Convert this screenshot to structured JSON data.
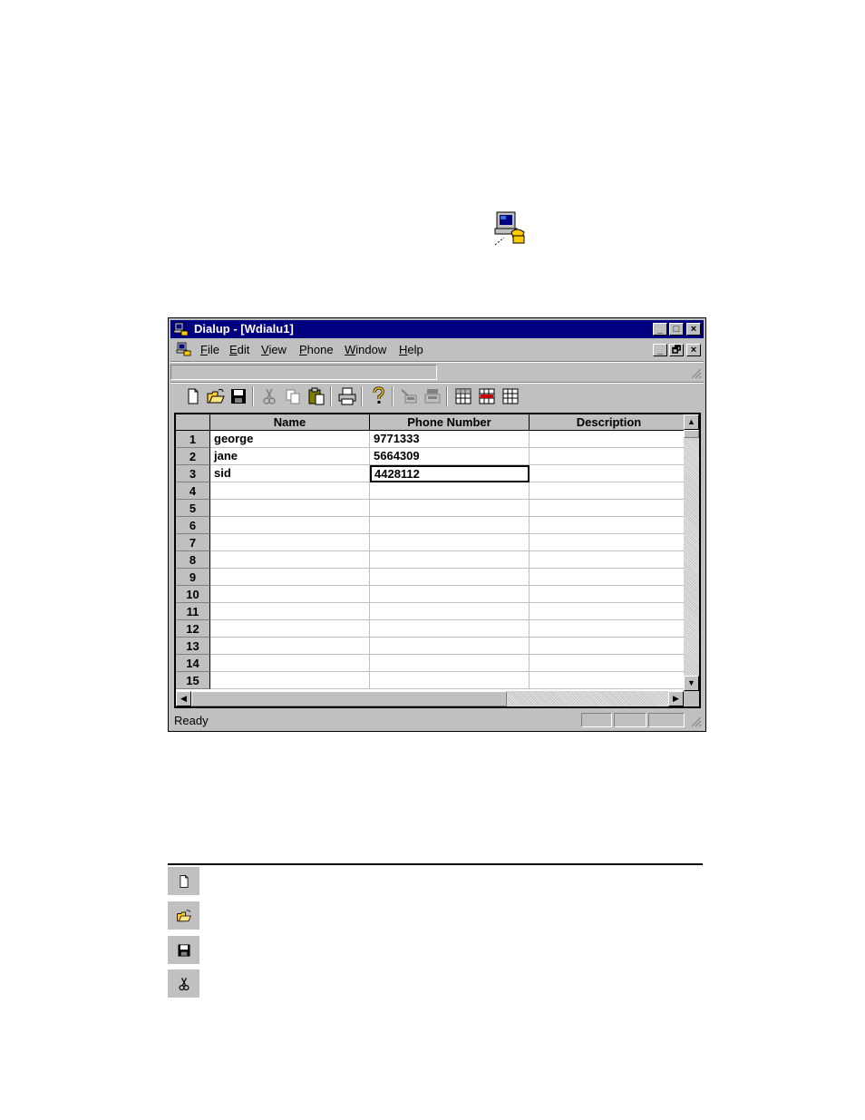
{
  "window": {
    "title": "Dialup - [Wdialu1]",
    "title_buttons": [
      "_",
      "□",
      "×"
    ],
    "child_buttons": [
      "_",
      "🗗",
      "×"
    ]
  },
  "menu": {
    "items": [
      {
        "label": "File",
        "key": "F",
        "rest": "ile"
      },
      {
        "label": "Edit",
        "key": "E",
        "rest": "dit"
      },
      {
        "label": "View",
        "key": "V",
        "rest": "iew"
      },
      {
        "label": "Phone",
        "key": "P",
        "rest": "hone"
      },
      {
        "label": "Window",
        "key": "W",
        "rest": "indow"
      },
      {
        "label": "Help",
        "key": "H",
        "rest": "elp"
      }
    ]
  },
  "toolbar": {
    "icons": [
      "new-file-icon",
      "open-folder-icon",
      "save-disk-icon",
      "cut-scissors-icon",
      "copy-icon",
      "paste-icon",
      "print-icon",
      "help-icon",
      "dial-icon",
      "hangup-icon",
      "grid-add-icon",
      "grid-remove-icon",
      "grid-icon"
    ]
  },
  "grid": {
    "columns": [
      "Name",
      "Phone Number",
      "Description"
    ],
    "rows": [
      {
        "num": "1",
        "name": "george",
        "phone": "9771333",
        "desc": ""
      },
      {
        "num": "2",
        "name": "jane",
        "phone": "5664309",
        "desc": ""
      },
      {
        "num": "3",
        "name": "sid",
        "phone": "4428112",
        "desc": ""
      },
      {
        "num": "4",
        "name": "",
        "phone": "",
        "desc": ""
      },
      {
        "num": "5",
        "name": "",
        "phone": "",
        "desc": ""
      },
      {
        "num": "6",
        "name": "",
        "phone": "",
        "desc": ""
      },
      {
        "num": "7",
        "name": "",
        "phone": "",
        "desc": ""
      },
      {
        "num": "8",
        "name": "",
        "phone": "",
        "desc": ""
      },
      {
        "num": "9",
        "name": "",
        "phone": "",
        "desc": ""
      },
      {
        "num": "10",
        "name": "",
        "phone": "",
        "desc": ""
      },
      {
        "num": "11",
        "name": "",
        "phone": "",
        "desc": ""
      },
      {
        "num": "12",
        "name": "",
        "phone": "",
        "desc": ""
      },
      {
        "num": "13",
        "name": "",
        "phone": "",
        "desc": ""
      },
      {
        "num": "14",
        "name": "",
        "phone": "",
        "desc": ""
      },
      {
        "num": "15",
        "name": "",
        "phone": "",
        "desc": ""
      }
    ],
    "selected": {
      "row": 3,
      "column": "Phone Number"
    }
  },
  "status": {
    "text": "Ready"
  },
  "legend": {
    "icons": [
      "new-file-icon",
      "open-folder-icon",
      "save-disk-icon",
      "cut-scissors-icon"
    ]
  },
  "colors": {
    "titlebar": "#000080",
    "face": "#c0c0c0"
  }
}
